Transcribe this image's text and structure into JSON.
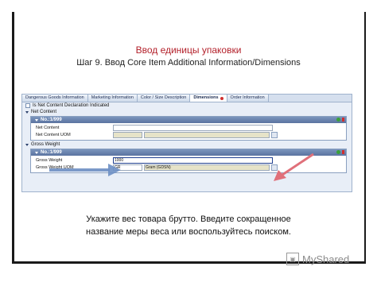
{
  "slide": {
    "title": "Ввод единицы упаковки",
    "subtitle": "Шаг 9. Ввод Core Item Additional Information/Dimensions",
    "caption_line1": "Укажите вес товара брутто. Введите сокращенное",
    "caption_line2": "название меры веса или воспользуйтесь поиском."
  },
  "app": {
    "tabs": [
      {
        "label": "Dangerous Goods Information"
      },
      {
        "label": "Marketing Information"
      },
      {
        "label": "Color / Size Description"
      },
      {
        "label": "Dimensions"
      },
      {
        "label": "Order Information"
      }
    ],
    "net_decl_label": "Is Net Content Declaration Indicated",
    "net_content": {
      "section_label": "Net Content",
      "group_label": "No.:1/999",
      "field1_label": "Net Content",
      "field1_value": "",
      "field2_label": "Net Content UOM",
      "field2_value": ""
    },
    "gross_weight": {
      "section_label": "Gross Weight",
      "group_label": "No.:1/999",
      "field1_label": "Gross Weight",
      "field1_value": "1000",
      "field2_label": "Gross Weight UOM",
      "uom_code": "GR",
      "uom_name": "Gram (GDSN)"
    }
  },
  "brand": {
    "name": "MyShared"
  },
  "colors": {
    "title": "#b3202a",
    "arrow_blue": "#6d8fc4",
    "arrow_pink": "#e0707a",
    "group_header": "#5b74a0"
  }
}
